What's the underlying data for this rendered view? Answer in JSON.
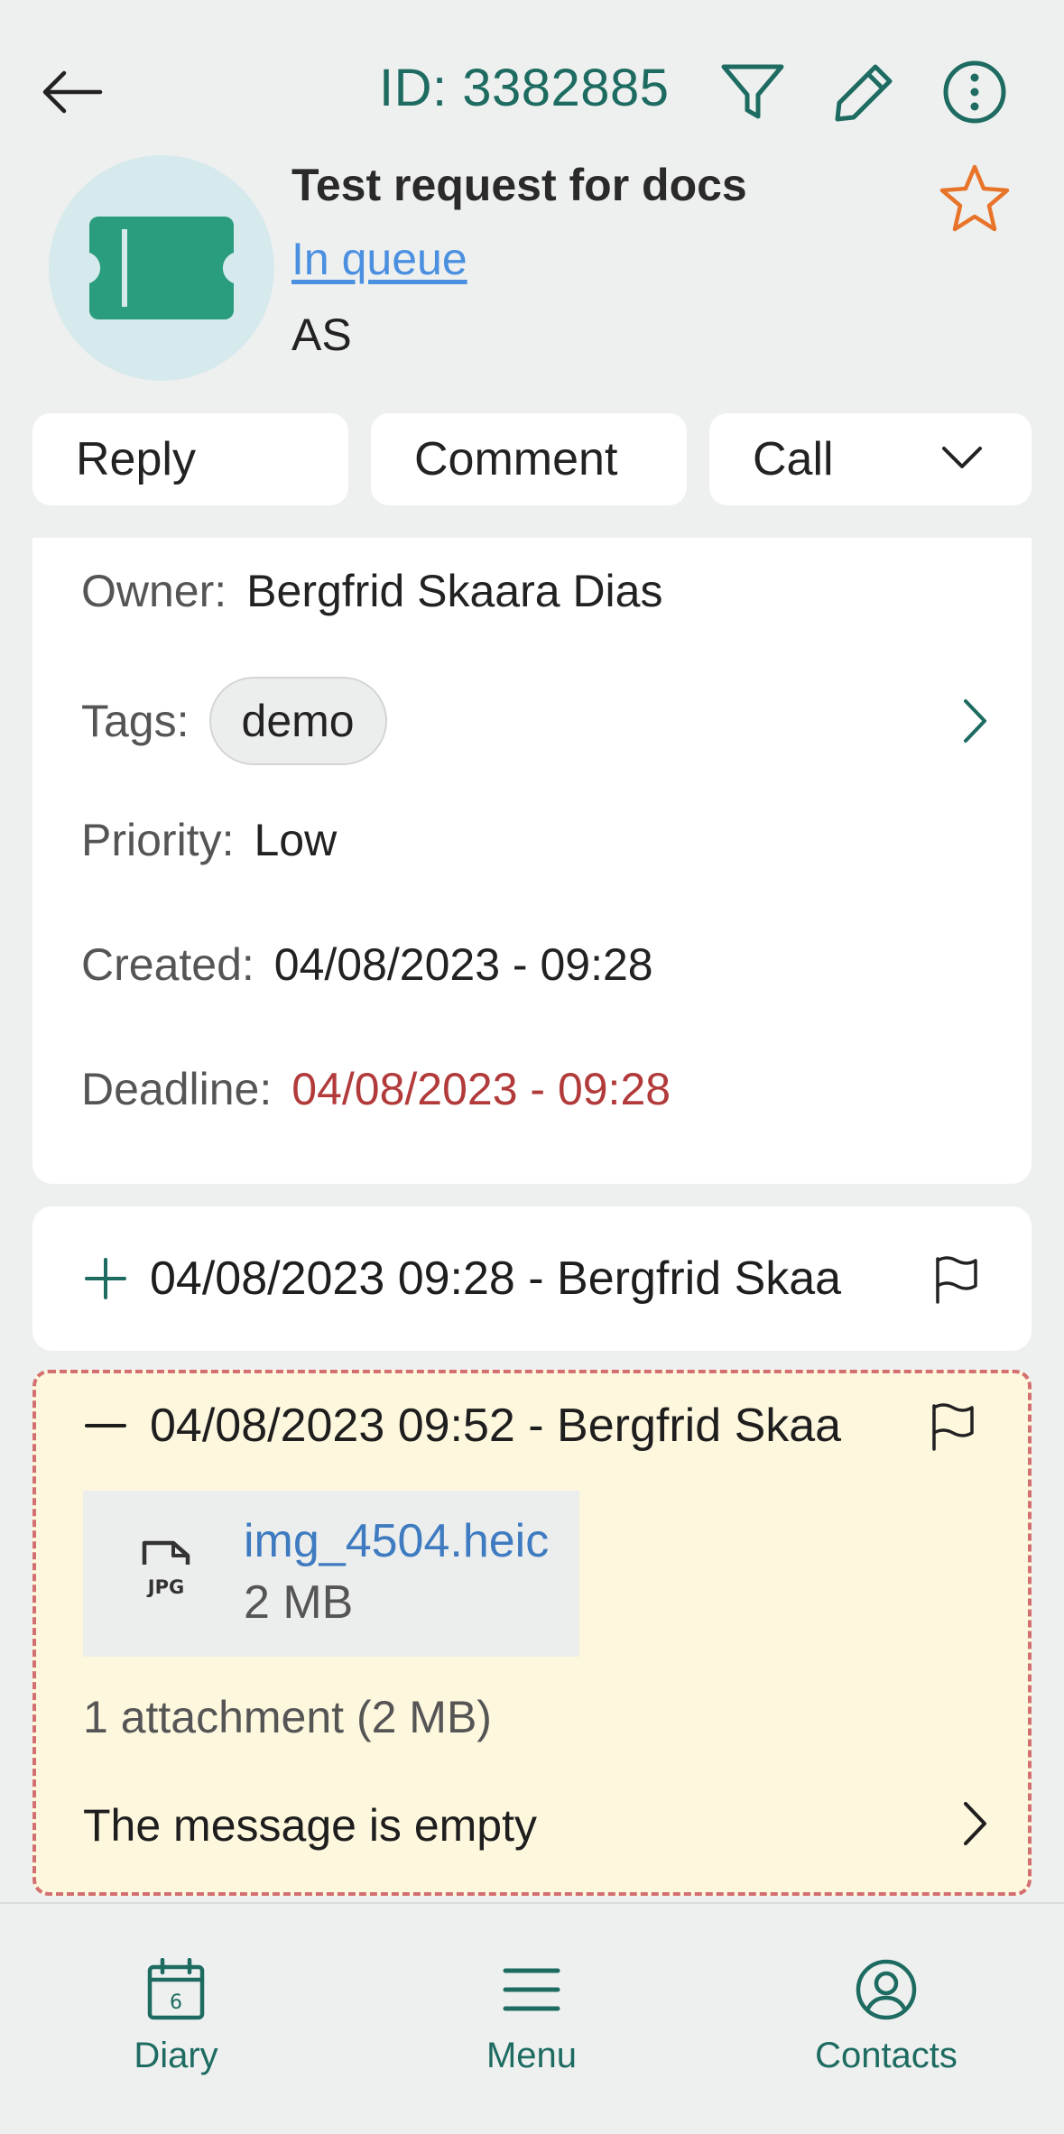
{
  "header": {
    "id_text": "ID: 3382885",
    "back_icon": "arrow-left-icon",
    "filter_icon": "filter-icon",
    "edit_icon": "pencil-icon",
    "more_icon": "more-vertical-icon"
  },
  "ticket": {
    "title": "Test request for docs",
    "status": "In queue",
    "initials": "AS",
    "avatar_icon": "ticket-icon",
    "favorite_icon": "star-outline-icon"
  },
  "actions": {
    "reply": "Reply",
    "comment": "Comment",
    "call": "Call"
  },
  "details": {
    "owner_label": "Owner:",
    "owner_value": "Bergfrid Skaara Dias",
    "tags_label": "Tags:",
    "tags": [
      "demo"
    ],
    "priority_label": "Priority:",
    "priority_value": "Low",
    "created_label": "Created:",
    "created_value": "04/08/2023 - 09:28",
    "deadline_label": "Deadline:",
    "deadline_value": "04/08/2023 - 09:28"
  },
  "events": [
    {
      "expanded": false,
      "text": "04/08/2023 09:28 - Bergfrid Skaa"
    },
    {
      "expanded": true,
      "text": "04/08/2023 09:52 - Bergfrid Skaa",
      "attachment": {
        "name": "img_4504.heic",
        "size": "2 MB",
        "type_icon": "jpg-file-icon"
      },
      "attachment_summary": "1 attachment (2 MB)",
      "message": "The message is empty"
    }
  ],
  "nav": {
    "diary": "Diary",
    "menu": "Menu",
    "contacts": "Contacts",
    "diary_day": "6"
  },
  "colors": {
    "accent": "#1d6b61",
    "link": "#4a8fe0",
    "deadline": "#b23a3a",
    "star": "#e8742a",
    "highlight_bg": "#fdf7de",
    "highlight_border": "#d46f6f"
  }
}
